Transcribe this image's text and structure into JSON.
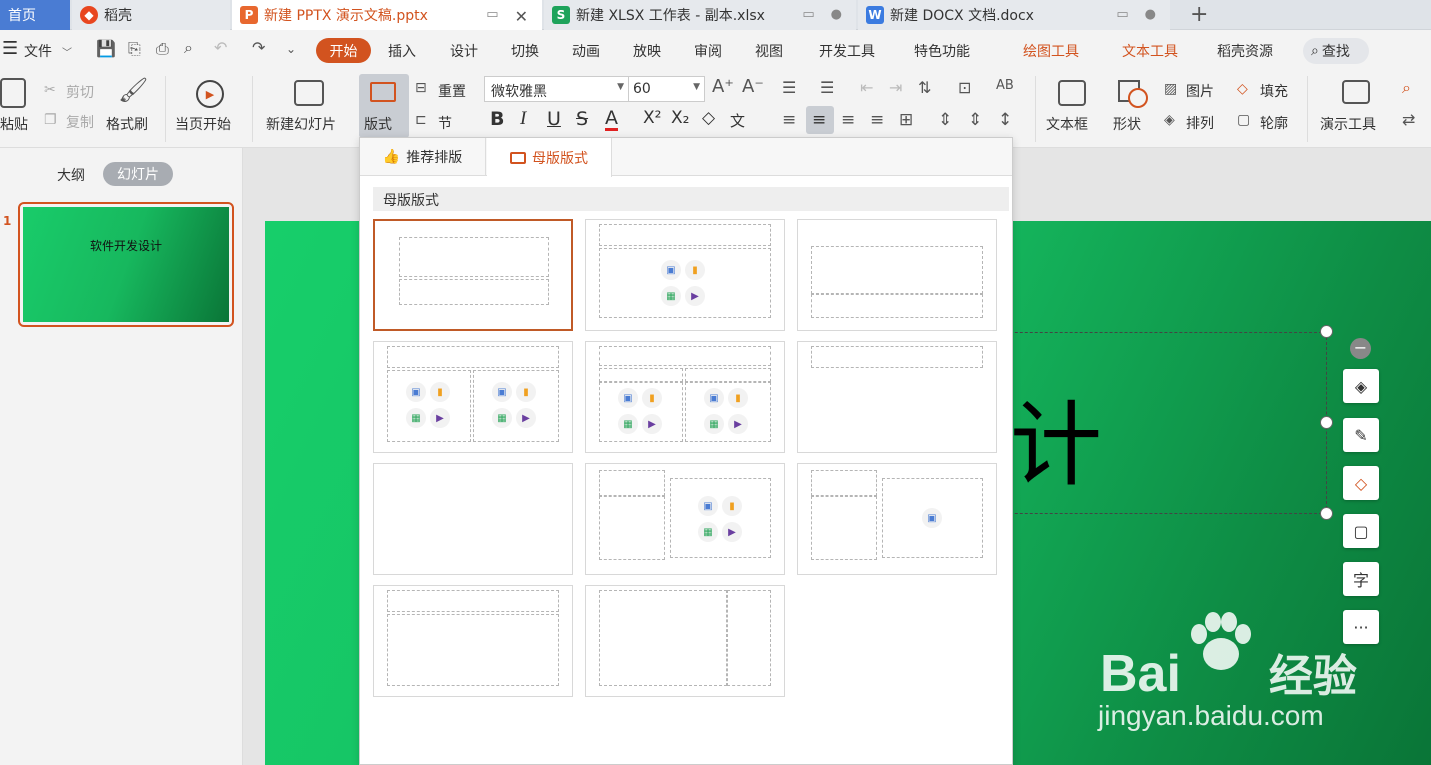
{
  "tabs": {
    "home": "首页",
    "daoke": "稻壳",
    "pptx": "新建 PPTX 演示文稿.pptx",
    "xlsx": "新建 XLSX 工作表 - 副本.xlsx",
    "docx": "新建 DOCX 文档.docx",
    "new_tab": "+"
  },
  "menu": {
    "file": "文件",
    "start": "开始",
    "insert": "插入",
    "design": "设计",
    "transition": "切换",
    "animation": "动画",
    "slideshow": "放映",
    "review": "审阅",
    "view": "视图",
    "developer": "开发工具",
    "special": "特色功能",
    "draw_tools": "绘图工具",
    "text_tools": "文本工具",
    "daoke_res": "稻壳资源",
    "search": "查找"
  },
  "ribbon": {
    "paste": "粘贴",
    "cut": "剪切",
    "copy": "复制",
    "format_painter": "格式刷",
    "from_current": "当页开始",
    "new_slide": "新建幻灯片",
    "layout": "版式",
    "reset": "重置",
    "section": "节",
    "font_name": "微软雅黑",
    "font_size": "60",
    "text_box": "文本框",
    "shape": "形状",
    "picture": "图片",
    "arrange": "排列",
    "fill": "填充",
    "outline": "轮廓",
    "present_tools": "演示工具"
  },
  "left_panel": {
    "outline_tab": "大纲",
    "slides_tab": "幻灯片",
    "slide_number": "1",
    "thumb_title": "软件开发设计"
  },
  "dropdown": {
    "tab_recommend": "推荐排版",
    "tab_master": "母版版式",
    "section_title": "母版版式"
  },
  "slide": {
    "title_visible": "计"
  },
  "side_tools": {
    "text_tool": "字",
    "more": "···"
  },
  "watermark": {
    "brand": "Bai",
    "brand_cn": "经验",
    "url": "jingyan.baidu.com"
  },
  "colors": {
    "accent": "#d2531f",
    "home_tab": "#4a7cd3",
    "slide_green": "#17ce6a",
    "slide_dark_green": "#0a7537"
  }
}
